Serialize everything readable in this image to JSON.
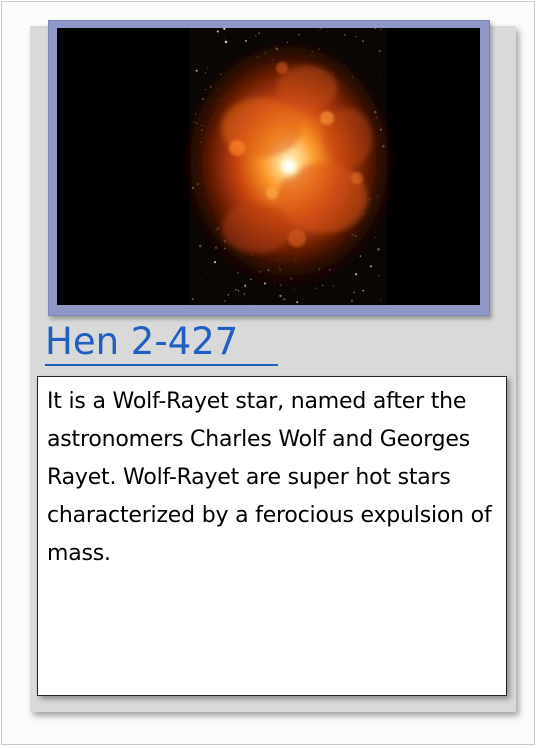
{
  "card": {
    "title": "Hen 2-427",
    "description": "It is a Wolf-Rayet star, named after the astronomers Charles Wolf and Georges Rayet. Wolf-Rayet are super hot stars characterized by a ferocious expulsion of mass."
  },
  "colors": {
    "title": "#1f5fbf",
    "frame": "#8e97c6",
    "card_background": "#d9d9d9"
  }
}
